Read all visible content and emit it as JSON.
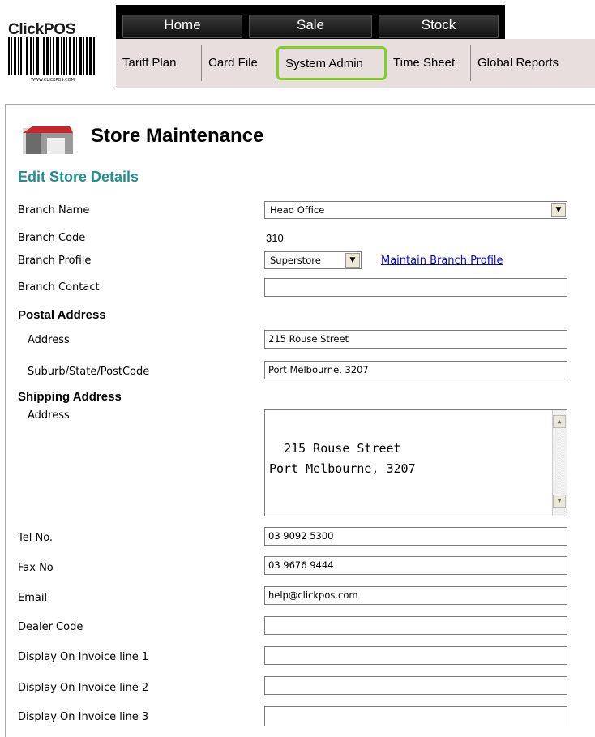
{
  "logo": {
    "text_a": "Click",
    "text_b": "POS",
    "barcode_caption": "WWW.CLICKPOS.COM"
  },
  "topnav": {
    "home": "Home",
    "sale": "Sale",
    "stock": "Stock"
  },
  "subnav": [
    "Tariff Plan",
    "Card File",
    "System Admin",
    "Time Sheet",
    "Global Reports"
  ],
  "page": {
    "title": "Store Maintenance",
    "section": "Edit Store Details"
  },
  "form": {
    "branch_name": {
      "label": "Branch Name",
      "value": "Head Office"
    },
    "branch_code": {
      "label": "Branch Code",
      "value": "310"
    },
    "branch_profile": {
      "label": "Branch Profile",
      "value": "Superstore",
      "link": "Maintain Branch Profile"
    },
    "branch_contact": {
      "label": "Branch Contact",
      "value": ""
    },
    "postal_heading": "Postal Address",
    "postal_address": {
      "label": "Address",
      "value": "215 Rouse Street"
    },
    "postal_suburb": {
      "label": "Suburb/State/PostCode",
      "value": "Port Melbourne, 3207"
    },
    "shipping_heading": "Shipping Address",
    "shipping_address": {
      "label": "Address",
      "value": "215 Rouse Street\nPort Melbourne, 3207"
    },
    "tel": {
      "label": "Tel No.",
      "value": "03 9092 5300"
    },
    "fax": {
      "label": "Fax No",
      "value": "03 9676 9444"
    },
    "email": {
      "label": "Email",
      "value": "help@clickpos.com"
    },
    "dealer_code": {
      "label": "Dealer Code",
      "value": ""
    },
    "invoice1": {
      "label": "Display On Invoice line 1",
      "value": ""
    },
    "invoice2": {
      "label": "Display On Invoice line 2",
      "value": ""
    },
    "invoice3": {
      "label": "Display On Invoice line 3",
      "value": ""
    }
  },
  "colors": {
    "accent": "#1f8f92",
    "highlight": "#7ed321",
    "subnav_bg": "#e8dede"
  }
}
